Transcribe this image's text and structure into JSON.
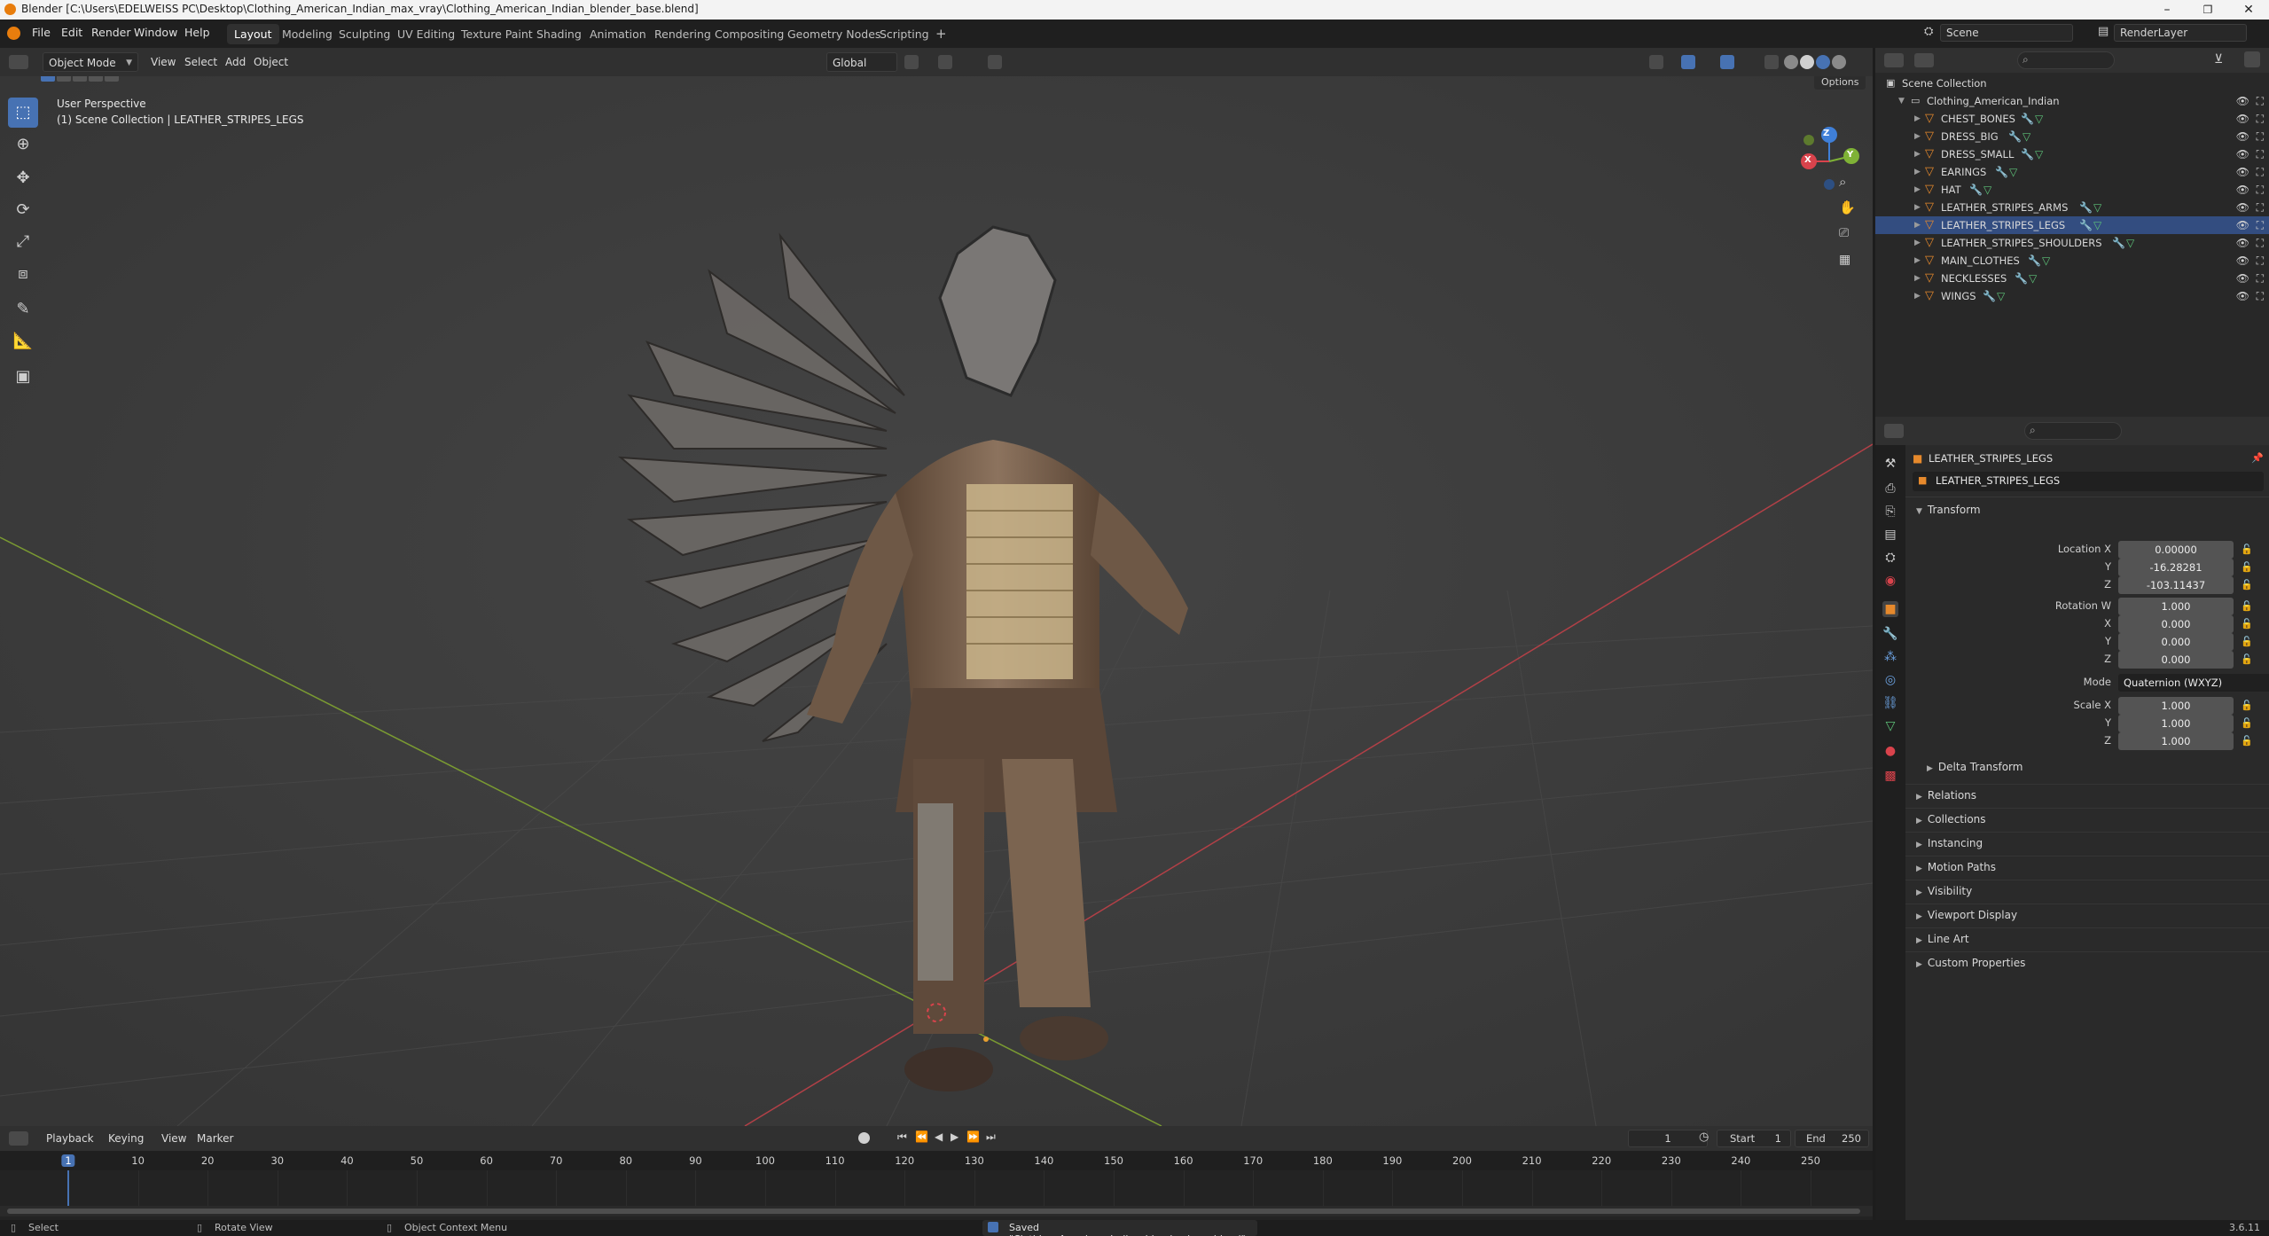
{
  "window": {
    "title": "Blender [C:\\Users\\EDELWEISS PC\\Desktop\\Clothing_American_Indian_max_vray\\Clothing_American_Indian_blender_base.blend]",
    "controls": [
      "–",
      "❐",
      "✕"
    ]
  },
  "menu": [
    "File",
    "Edit",
    "Render",
    "Window",
    "Help"
  ],
  "workspaces": {
    "tabs": [
      "Layout",
      "Modeling",
      "Sculpting",
      "UV Editing",
      "Texture Paint",
      "Shading",
      "Animation",
      "Rendering",
      "Compositing",
      "Geometry Nodes",
      "Scripting"
    ],
    "active": "Layout",
    "add": "+"
  },
  "scene": {
    "scene_name": "Scene",
    "render_layer": "RenderLayer"
  },
  "viewport_header": {
    "mode": "Object Mode",
    "menus": [
      "View",
      "Select",
      "Add",
      "Object"
    ],
    "orientation": "Global",
    "options": "Options"
  },
  "viewport": {
    "perspective": "User Perspective",
    "collection_info": "(1) Scene Collection | LEATHER_STRIPES_LEGS",
    "gizmo": {
      "x": "X",
      "y": "Y",
      "z": "Z"
    }
  },
  "outliner": {
    "root": "Scene Collection",
    "collection": "Clothing_American_Indian",
    "selected": "LEATHER_STRIPES_LEGS",
    "items": [
      "CHEST_BONES",
      "DRESS_BIG",
      "DRESS_SMALL",
      "EARINGS",
      "HAT",
      "LEATHER_STRIPES_ARMS",
      "LEATHER_STRIPES_LEGS",
      "LEATHER_STRIPES_SHOULDERS",
      "MAIN_CLOTHES",
      "NECKLESSES",
      "WINGS"
    ]
  },
  "properties": {
    "object_name": "LEATHER_STRIPES_LEGS",
    "data_name": "LEATHER_STRIPES_LEGS",
    "transform": {
      "title": "Transform",
      "location_label": "Location X",
      "location": [
        "0.00000",
        "-16.28281",
        "-103.11437"
      ],
      "rotation_label": "Rotation W",
      "rotation": [
        "1.000",
        "0.000",
        "0.000",
        "0.000"
      ],
      "mode_label": "Mode",
      "mode": "Quaternion (WXYZ)",
      "scale_label": "Scale X",
      "scale": [
        "1.000",
        "1.000",
        "1.000"
      ],
      "axis_y": "Y",
      "axis_z": "Z",
      "axis_x": "X"
    },
    "sections": [
      "Delta Transform",
      "Relations",
      "Collections",
      "Instancing",
      "Motion Paths",
      "Visibility",
      "Viewport Display",
      "Line Art",
      "Custom Properties"
    ]
  },
  "timeline": {
    "menus": [
      "Playback",
      "Keying",
      "View",
      "Marker"
    ],
    "current_frame": "1",
    "start_label": "Start",
    "start": "1",
    "end_label": "End",
    "end": "250",
    "ticks": [
      "1",
      "10",
      "20",
      "30",
      "40",
      "50",
      "60",
      "70",
      "80",
      "90",
      "100",
      "110",
      "120",
      "130",
      "140",
      "150",
      "160",
      "170",
      "180",
      "190",
      "200",
      "210",
      "220",
      "230",
      "240",
      "250"
    ]
  },
  "statusbar": {
    "select": "Select",
    "rotate": "Rotate View",
    "context": "Object Context Menu",
    "message": "Saved \"Clothing_American_Indian_blender_base.blend\"",
    "version": "3.6.11"
  },
  "colors": {
    "accent": "#4772b3",
    "object_orange": "#e6892c",
    "x_axis": "#d9434c",
    "y_axis": "#7fb236",
    "z_axis": "#3f7fd8"
  }
}
